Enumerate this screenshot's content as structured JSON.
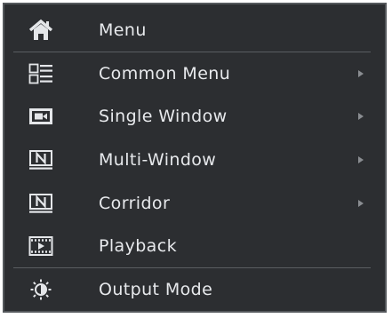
{
  "menu": {
    "items": [
      {
        "label": "Menu",
        "icon": "home-icon",
        "has_submenu": false
      },
      {
        "label": "Common Menu",
        "icon": "common-menu-icon",
        "has_submenu": true
      },
      {
        "label": "Single Window",
        "icon": "single-window-icon",
        "has_submenu": true
      },
      {
        "label": "Multi-Window",
        "icon": "multi-window-icon",
        "has_submenu": true
      },
      {
        "label": "Corridor",
        "icon": "corridor-icon",
        "has_submenu": true
      },
      {
        "label": "Playback",
        "icon": "playback-icon",
        "has_submenu": false
      },
      {
        "label": "Output Mode",
        "icon": "output-mode-icon",
        "has_submenu": false
      }
    ]
  },
  "colors": {
    "background": "#2c2e31",
    "text": "#e7e9ec",
    "icon": "#e4e6e9",
    "divider": "#5a5d61",
    "arrow": "#8a8d91"
  }
}
